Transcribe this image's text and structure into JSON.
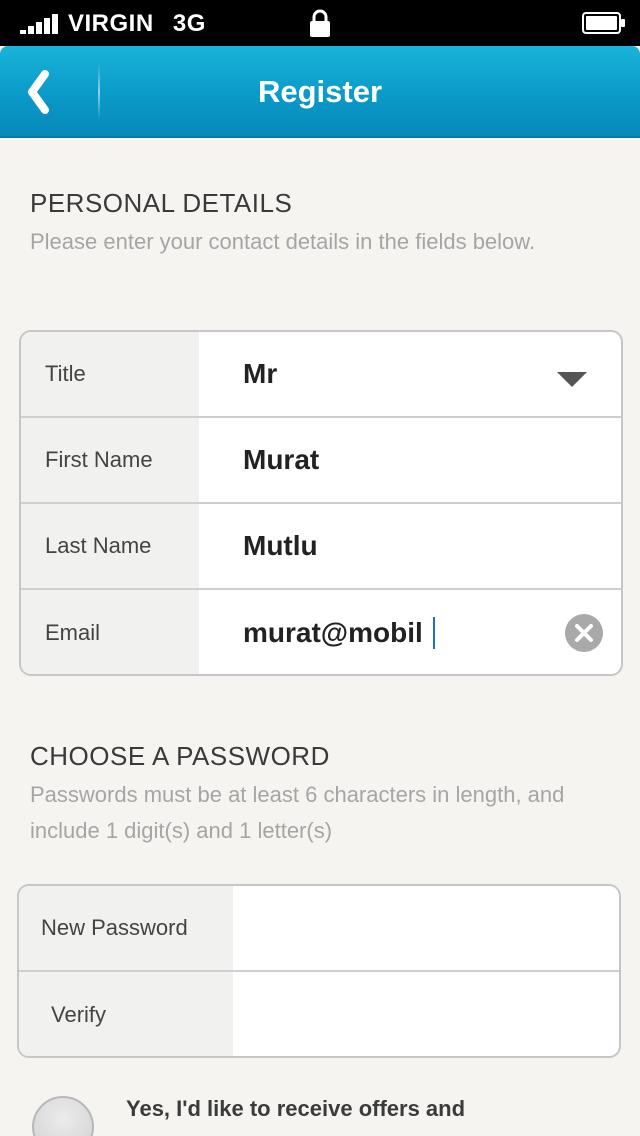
{
  "status_bar": {
    "carrier": "VIRGIN",
    "network": "3G",
    "signal_bars": 5,
    "icons": [
      "signal-icon",
      "lock-icon",
      "battery-icon"
    ]
  },
  "nav": {
    "title": "Register",
    "back_icon": "chevron-left-icon",
    "color": "#0a9ac9"
  },
  "personal": {
    "heading": "PERSONAL DETAILS",
    "description": "Please enter your contact details in the fields below.",
    "fields": {
      "title": {
        "label": "Title",
        "value": "Mr",
        "control": "dropdown"
      },
      "first_name": {
        "label": "First Name",
        "value": "Murat"
      },
      "last_name": {
        "label": "Last Name",
        "value": "Mutlu"
      },
      "email": {
        "label": "Email",
        "value": "murat@mobil",
        "focused": true
      }
    }
  },
  "password": {
    "heading": "CHOOSE A PASSWORD",
    "description": "Passwords must be at least 6 characters in length, and include 1 digit(s) and 1 letter(s)",
    "fields": {
      "new_password": {
        "label": "New Password",
        "value": ""
      },
      "verify": {
        "label": "Verify",
        "value": ""
      }
    }
  },
  "offers": {
    "label": "Yes, I'd like to receive offers and",
    "checked": false
  },
  "colors": {
    "background": "#f5f4f0",
    "accent": "#0a9ac9",
    "caret": "#1d6fd6"
  }
}
